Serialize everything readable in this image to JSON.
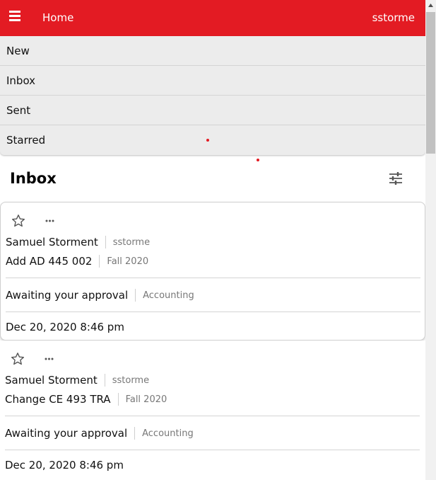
{
  "header": {
    "home_label": "Home",
    "username": "sstorme"
  },
  "nav_menu": {
    "items": [
      {
        "label": "New"
      },
      {
        "label": "Inbox"
      },
      {
        "label": "Sent"
      },
      {
        "label": "Starred"
      }
    ]
  },
  "page": {
    "title": "Inbox"
  },
  "requests": [
    {
      "requester_name": "Samuel Storment",
      "requester_id": "sstorme",
      "action": "Add AD 445 002",
      "term": "Fall 2020",
      "status": "Awaiting your approval",
      "department": "Accounting",
      "date": "Dec 20, 2020 8:46 pm"
    },
    {
      "requester_name": "Samuel Storment",
      "requester_id": "sstorme",
      "action": "Change CE 493 TRA",
      "term": "Fall 2020",
      "status": "Awaiting your approval",
      "department": "Accounting",
      "date": "Dec 20, 2020 8:46 pm"
    }
  ],
  "icons": {
    "menu": "hamburger-menu-icon",
    "filter": "sliders-icon",
    "star": "star-outline-icon",
    "more": "more-horizontal-icon"
  },
  "colors": {
    "brand_red": "#e31b23",
    "menu_background": "#ececec",
    "muted_text": "#777777"
  }
}
